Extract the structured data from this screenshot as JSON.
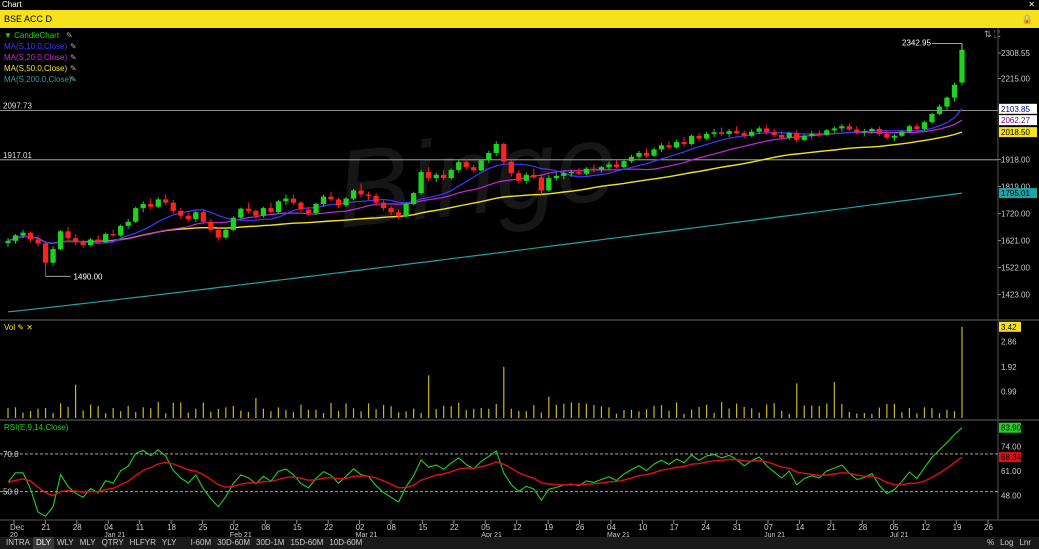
{
  "window": {
    "title": "Chart",
    "close": "✕"
  },
  "header": {
    "title": "BSE ACC D",
    "lock_icon": "lock-icon"
  },
  "watermark": "Binge",
  "indicators": {
    "price": [
      {
        "label": "CandleChart",
        "color": "#1fd21f"
      },
      {
        "label": "MA(S,10.0,Close)",
        "color": "#3a3aff"
      },
      {
        "label": "MA(S,20.0,Close)",
        "color": "#c02ad8"
      },
      {
        "label": "MA(S,50.0,Close)",
        "color": "#f5e21b"
      },
      {
        "label": "MA(S,200.0,Close)",
        "color": "#1fa3a3"
      }
    ],
    "vol": {
      "label": "Vol",
      "color": "#f5e21b"
    },
    "rsi": {
      "label": "RSI(E,9,14,Close)",
      "color": "#1fd21f",
      "signal_color": "#e01010"
    }
  },
  "toolbar": {
    "periods": [
      "INTRA",
      "DLY",
      "WLY",
      "MLY",
      "QTRY",
      "HLFYR",
      "YLY"
    ],
    "active": "DLY",
    "intervals": [
      "I-60M",
      "30D-60M",
      "30D-1M",
      "15D-60M",
      "10D-60M"
    ],
    "right": [
      "%",
      "Log",
      "Lnr"
    ]
  },
  "chart_data": [
    {
      "type": "candlestick",
      "title": "BSE ACC D",
      "ylim": [
        1330,
        2400
      ],
      "y_ticks": [
        2308.55,
        2215.0,
        2103.85,
        1918.0,
        1819.0,
        1720.0,
        1621.0,
        1522.0,
        1423.0
      ],
      "y_tick_labels": [
        "2308.55",
        "2215.00",
        "2103.85",
        "1918.00",
        "1819.00",
        "1720.00",
        "1621.00",
        "1522.00",
        "1423.00"
      ],
      "last_labels": [
        {
          "name": "MA(S,10.0,Close)",
          "value": "2103.85",
          "bg": "#ffffff",
          "fg": "#000080"
        },
        {
          "name": "MA(S,20.0,Close)",
          "value": "2062.27",
          "bg": "#ffffff",
          "fg": "#800080"
        },
        {
          "name": "MA(S,50.0,Close)",
          "value": "2018.50",
          "bg": "#f5e21b",
          "fg": "#000000"
        },
        {
          "name": "MA(S,200.0,Close)",
          "value": "1795.01",
          "bg": "#1fa3a3",
          "fg": "#000000"
        }
      ],
      "hlines": [
        {
          "value": 2097.73,
          "label": "2097.73"
        },
        {
          "value": 1917.01,
          "label": "1917.01"
        }
      ],
      "annotations": [
        {
          "text": "2342.95",
          "value": 2342.95
        },
        {
          "text": "1490.00",
          "value": 1490.0
        }
      ],
      "x_ticks": [
        "Dec 20",
        "21",
        "28",
        "04 Jan 21",
        "11",
        "18",
        "25",
        "02 Feb 21",
        "08",
        "15",
        "22",
        "02 Mar 21",
        "08",
        "15",
        "22",
        "05 Apr 21",
        "12",
        "19",
        "26",
        "04 May 21",
        "10",
        "17",
        "24",
        "31",
        "07 Jun 21",
        "14",
        "21",
        "28",
        "05 Jul 21",
        "12",
        "19",
        "26"
      ],
      "ohlc": [
        [
          1612,
          1630,
          1598,
          1620
        ],
        [
          1620,
          1645,
          1610,
          1640
        ],
        [
          1640,
          1660,
          1630,
          1650
        ],
        [
          1650,
          1655,
          1615,
          1625
        ],
        [
          1625,
          1640,
          1600,
          1610
        ],
        [
          1610,
          1618,
          1490,
          1540
        ],
        [
          1540,
          1600,
          1530,
          1590
        ],
        [
          1590,
          1660,
          1585,
          1655
        ],
        [
          1655,
          1670,
          1620,
          1630
        ],
        [
          1630,
          1645,
          1605,
          1615
        ],
        [
          1615,
          1625,
          1595,
          1605
        ],
        [
          1605,
          1630,
          1600,
          1625
        ],
        [
          1625,
          1640,
          1610,
          1615
        ],
        [
          1615,
          1650,
          1610,
          1645
        ],
        [
          1645,
          1660,
          1635,
          1640
        ],
        [
          1640,
          1680,
          1635,
          1675
        ],
        [
          1675,
          1700,
          1665,
          1690
        ],
        [
          1690,
          1745,
          1685,
          1740
        ],
        [
          1740,
          1765,
          1725,
          1755
        ],
        [
          1755,
          1775,
          1735,
          1745
        ],
        [
          1745,
          1780,
          1740,
          1772
        ],
        [
          1772,
          1790,
          1750,
          1760
        ],
        [
          1760,
          1770,
          1720,
          1730
        ],
        [
          1730,
          1740,
          1700,
          1712
        ],
        [
          1712,
          1725,
          1690,
          1700
        ],
        [
          1700,
          1730,
          1690,
          1725
        ],
        [
          1725,
          1735,
          1680,
          1690
        ],
        [
          1690,
          1700,
          1650,
          1660
        ],
        [
          1660,
          1672,
          1620,
          1632
        ],
        [
          1632,
          1665,
          1625,
          1660
        ],
        [
          1660,
          1710,
          1655,
          1705
        ],
        [
          1705,
          1742,
          1700,
          1738
        ],
        [
          1738,
          1760,
          1720,
          1730
        ],
        [
          1730,
          1735,
          1700,
          1712
        ],
        [
          1712,
          1745,
          1705,
          1740
        ],
        [
          1740,
          1760,
          1720,
          1726
        ],
        [
          1726,
          1770,
          1720,
          1765
        ],
        [
          1765,
          1790,
          1750,
          1775
        ],
        [
          1775,
          1790,
          1752,
          1760
        ],
        [
          1760,
          1765,
          1725,
          1735
        ],
        [
          1735,
          1745,
          1712,
          1722
        ],
        [
          1722,
          1760,
          1715,
          1755
        ],
        [
          1755,
          1790,
          1745,
          1782
        ],
        [
          1782,
          1800,
          1765,
          1772
        ],
        [
          1772,
          1778,
          1740,
          1750
        ],
        [
          1750,
          1780,
          1745,
          1775
        ],
        [
          1775,
          1810,
          1770,
          1805
        ],
        [
          1805,
          1830,
          1780,
          1790
        ],
        [
          1790,
          1800,
          1770,
          1785
        ],
        [
          1785,
          1795,
          1750,
          1760
        ],
        [
          1760,
          1768,
          1730,
          1740
        ],
        [
          1740,
          1748,
          1715,
          1725
        ],
        [
          1725,
          1735,
          1700,
          1710
        ],
        [
          1710,
          1760,
          1705,
          1755
        ],
        [
          1755,
          1800,
          1750,
          1795
        ],
        [
          1795,
          1880,
          1790,
          1872
        ],
        [
          1872,
          1890,
          1840,
          1850
        ],
        [
          1850,
          1870,
          1835,
          1862
        ],
        [
          1862,
          1880,
          1842,
          1850
        ],
        [
          1850,
          1885,
          1845,
          1880
        ],
        [
          1880,
          1915,
          1870,
          1908
        ],
        [
          1908,
          1920,
          1880,
          1890
        ],
        [
          1890,
          1900,
          1870,
          1878
        ],
        [
          1878,
          1920,
          1875,
          1915
        ],
        [
          1915,
          1950,
          1905,
          1942
        ],
        [
          1942,
          1985,
          1930,
          1975
        ],
        [
          1975,
          1980,
          1900,
          1910
        ],
        [
          1910,
          1915,
          1855,
          1868
        ],
        [
          1868,
          1880,
          1830,
          1840
        ],
        [
          1840,
          1870,
          1830,
          1862
        ],
        [
          1862,
          1885,
          1845,
          1852
        ],
        [
          1852,
          1860,
          1790,
          1805
        ],
        [
          1805,
          1860,
          1800,
          1850
        ],
        [
          1850,
          1870,
          1840,
          1858
        ],
        [
          1858,
          1875,
          1845,
          1868
        ],
        [
          1868,
          1880,
          1855,
          1872
        ],
        [
          1872,
          1885,
          1860,
          1866
        ],
        [
          1866,
          1890,
          1860,
          1884
        ],
        [
          1884,
          1900,
          1872,
          1880
        ],
        [
          1880,
          1895,
          1870,
          1890
        ],
        [
          1890,
          1910,
          1880,
          1900
        ],
        [
          1900,
          1915,
          1885,
          1890
        ],
        [
          1890,
          1920,
          1885,
          1912
        ],
        [
          1912,
          1935,
          1905,
          1928
        ],
        [
          1928,
          1950,
          1920,
          1942
        ],
        [
          1942,
          1958,
          1925,
          1932
        ],
        [
          1932,
          1962,
          1928,
          1955
        ],
        [
          1955,
          1978,
          1945,
          1970
        ],
        [
          1970,
          1985,
          1955,
          1962
        ],
        [
          1962,
          1990,
          1958,
          1982
        ],
        [
          1982,
          2000,
          1965,
          1975
        ],
        [
          1975,
          2010,
          1970,
          2005
        ],
        [
          2005,
          2015,
          1985,
          1995
        ],
        [
          1995,
          2020,
          1990,
          2012
        ],
        [
          2012,
          2030,
          2000,
          2018
        ],
        [
          2018,
          2035,
          2005,
          2012
        ],
        [
          2012,
          2030,
          2000,
          2022
        ],
        [
          2022,
          2040,
          2010,
          2015
        ],
        [
          2015,
          2025,
          1995,
          2005
        ],
        [
          2005,
          2028,
          2000,
          2020
        ],
        [
          2020,
          2040,
          2010,
          2032
        ],
        [
          2032,
          2045,
          2010,
          2018
        ],
        [
          2018,
          2030,
          2000,
          2008
        ],
        [
          2008,
          2022,
          1990,
          1998
        ],
        [
          1998,
          2020,
          1990,
          2015
        ],
        [
          2015,
          2025,
          1980,
          1990
        ],
        [
          1990,
          2010,
          1985,
          2005
        ],
        [
          2005,
          2022,
          1995,
          2012
        ],
        [
          2012,
          2025,
          2000,
          2008
        ],
        [
          2008,
          2030,
          2005,
          2025
        ],
        [
          2025,
          2040,
          2015,
          2032
        ],
        [
          2032,
          2048,
          2020,
          2040
        ],
        [
          2040,
          2050,
          2022,
          2028
        ],
        [
          2028,
          2040,
          2010,
          2018
        ],
        [
          2018,
          2030,
          2005,
          2022
        ],
        [
          2022,
          2035,
          2012,
          2030
        ],
        [
          2030,
          2040,
          2005,
          2012
        ],
        [
          2012,
          2025,
          1990,
          1998
        ],
        [
          1998,
          2012,
          1985,
          2005
        ],
        [
          2005,
          2025,
          2000,
          2020
        ],
        [
          2020,
          2045,
          2015,
          2040
        ],
        [
          2040,
          2050,
          2020,
          2030
        ],
        [
          2030,
          2060,
          2025,
          2055
        ],
        [
          2055,
          2090,
          2050,
          2085
        ],
        [
          2085,
          2120,
          2080,
          2112
        ],
        [
          2112,
          2150,
          2100,
          2145
        ],
        [
          2145,
          2200,
          2130,
          2192
        ],
        [
          2200,
          2342.95,
          2190,
          2320
        ]
      ],
      "ma10_end": 2103.85,
      "ma20_end": 2062.27,
      "ma50_end": 2018.5,
      "ma200_end": 1795.01
    },
    {
      "type": "bar",
      "title": "Vol",
      "ylim": [
        0,
        3.6
      ],
      "y_ticks": [
        3.42,
        2.86,
        1.92,
        0.99
      ],
      "y_tick_labels": [
        "3.42",
        "2.86",
        "1.92",
        "0.99"
      ],
      "last_label": {
        "value": "3.42",
        "bg": "#f5e21b",
        "fg": "#000000"
      }
    },
    {
      "type": "line",
      "title": "RSI(E,9,14,Close)",
      "ylim": [
        35,
        88
      ],
      "y_ticks": [
        74.0,
        61.0,
        48.0
      ],
      "y_tick_labels": [
        "74.00",
        "61.00",
        "48.00"
      ],
      "hlines": [
        {
          "value": 70.0,
          "label": "70.0"
        },
        {
          "value": 50.0,
          "label": "50.0"
        }
      ],
      "last_labels": [
        {
          "name": "RSI",
          "value": "83.90",
          "bg": "#1fd21f",
          "fg": "#000000"
        },
        {
          "name": "Signal",
          "value": "68.34",
          "bg": "#e01010",
          "fg": "#000000"
        }
      ]
    }
  ]
}
